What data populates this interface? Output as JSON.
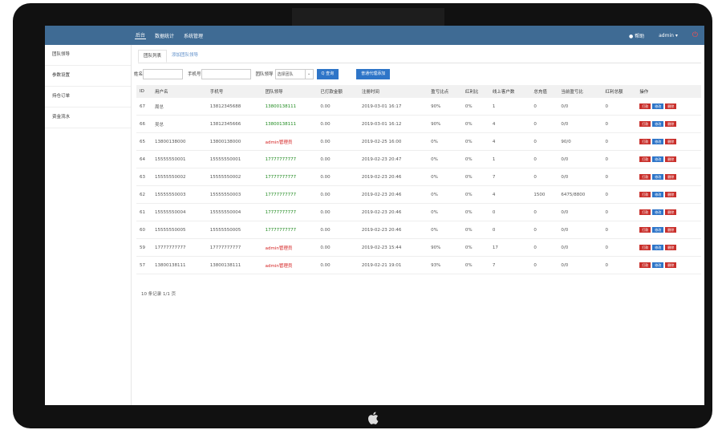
{
  "topnav": [
    "后台",
    "数据统计",
    "系统管理"
  ],
  "topright": {
    "help": "帮助",
    "user": "admin",
    "power_icon": "power-icon"
  },
  "sidebar": [
    "团队领导",
    "参数设置",
    "持仓订单",
    "资金流水"
  ],
  "tabs": [
    "团队列表",
    "添加团队领导"
  ],
  "filter": {
    "name_label": "姓名",
    "phone_label": "手机号",
    "leader_label": "团队领导",
    "select_value": "选择团队",
    "query": "Q 查询",
    "action": "普通代理添加"
  },
  "table": {
    "headers": [
      "ID",
      "用户名",
      "手机号",
      "团队领导",
      "已打款金额",
      "注册时间",
      "盈亏比点",
      "红利比",
      "线上客户数",
      "总充值",
      "当前盈亏比",
      "红利总额",
      "操作"
    ],
    "rows": [
      {
        "id": "67",
        "user": "周总",
        "phone": "13812345688",
        "leader": "13800138111",
        "lc": "green",
        "paid": "0.00",
        "time": "2019-03-01 16:17",
        "rate": "90%",
        "bonus": "0%",
        "online": "1",
        "recharge": "0",
        "cur": "0/0",
        "total": "0"
      },
      {
        "id": "66",
        "user": "吴总",
        "phone": "13812345666",
        "leader": "13800138111",
        "lc": "green",
        "paid": "0.00",
        "time": "2019-03-01 16:12",
        "rate": "90%",
        "bonus": "0%",
        "online": "4",
        "recharge": "0",
        "cur": "0/0",
        "total": "0"
      },
      {
        "id": "65",
        "user": "13800138000",
        "phone": "13800138000",
        "leader": "admin管理员",
        "lc": "red",
        "paid": "0.00",
        "time": "2019-02-25 16:00",
        "rate": "0%",
        "bonus": "0%",
        "online": "4",
        "recharge": "0",
        "cur": "90/0",
        "total": "0"
      },
      {
        "id": "64",
        "user": "15555550001",
        "phone": "15555550001",
        "leader": "17777777777",
        "lc": "green",
        "paid": "0.00",
        "time": "2019-02-23 20:47",
        "rate": "0%",
        "bonus": "0%",
        "online": "1",
        "recharge": "0",
        "cur": "0/0",
        "total": "0"
      },
      {
        "id": "63",
        "user": "15555550002",
        "phone": "15555550002",
        "leader": "17777777777",
        "lc": "green",
        "paid": "0.00",
        "time": "2019-02-23 20:46",
        "rate": "0%",
        "bonus": "0%",
        "online": "7",
        "recharge": "0",
        "cur": "0/0",
        "total": "0"
      },
      {
        "id": "62",
        "user": "15555550003",
        "phone": "15555550003",
        "leader": "17777777777",
        "lc": "green",
        "paid": "0.00",
        "time": "2019-02-23 20:46",
        "rate": "0%",
        "bonus": "0%",
        "online": "4",
        "recharge": "1500",
        "cur": "6475/8800",
        "total": "0"
      },
      {
        "id": "61",
        "user": "15555550004",
        "phone": "15555550004",
        "leader": "17777777777",
        "lc": "green",
        "paid": "0.00",
        "time": "2019-02-23 20:46",
        "rate": "0%",
        "bonus": "0%",
        "online": "0",
        "recharge": "0",
        "cur": "0/0",
        "total": "0"
      },
      {
        "id": "60",
        "user": "15555550005",
        "phone": "15555550005",
        "leader": "17777777777",
        "lc": "green",
        "paid": "0.00",
        "time": "2019-02-23 20:46",
        "rate": "0%",
        "bonus": "0%",
        "online": "0",
        "recharge": "0",
        "cur": "0/0",
        "total": "0"
      },
      {
        "id": "59",
        "user": "17777777777",
        "phone": "17777777777",
        "leader": "admin管理员",
        "lc": "red",
        "paid": "0.00",
        "time": "2019-02-23 15:44",
        "rate": "90%",
        "bonus": "0%",
        "online": "17",
        "recharge": "0",
        "cur": "0/0",
        "total": "0"
      },
      {
        "id": "57",
        "user": "13800138111",
        "phone": "13800138111",
        "leader": "admin管理员",
        "lc": "red",
        "paid": "0.00",
        "time": "2019-02-21 19:01",
        "rate": "93%",
        "bonus": "0%",
        "online": "7",
        "recharge": "0",
        "cur": "0/0",
        "total": "0"
      }
    ],
    "ops": [
      "打款",
      "修改",
      "删除"
    ]
  },
  "footer": "10 条记录 1/1 页",
  "colors": {
    "topbar": "#3f6b94",
    "link_green": "#1f8a1f",
    "admin_red": "#d42020",
    "btn_blue": "#2e75c8",
    "btn_red": "#c9302c"
  }
}
